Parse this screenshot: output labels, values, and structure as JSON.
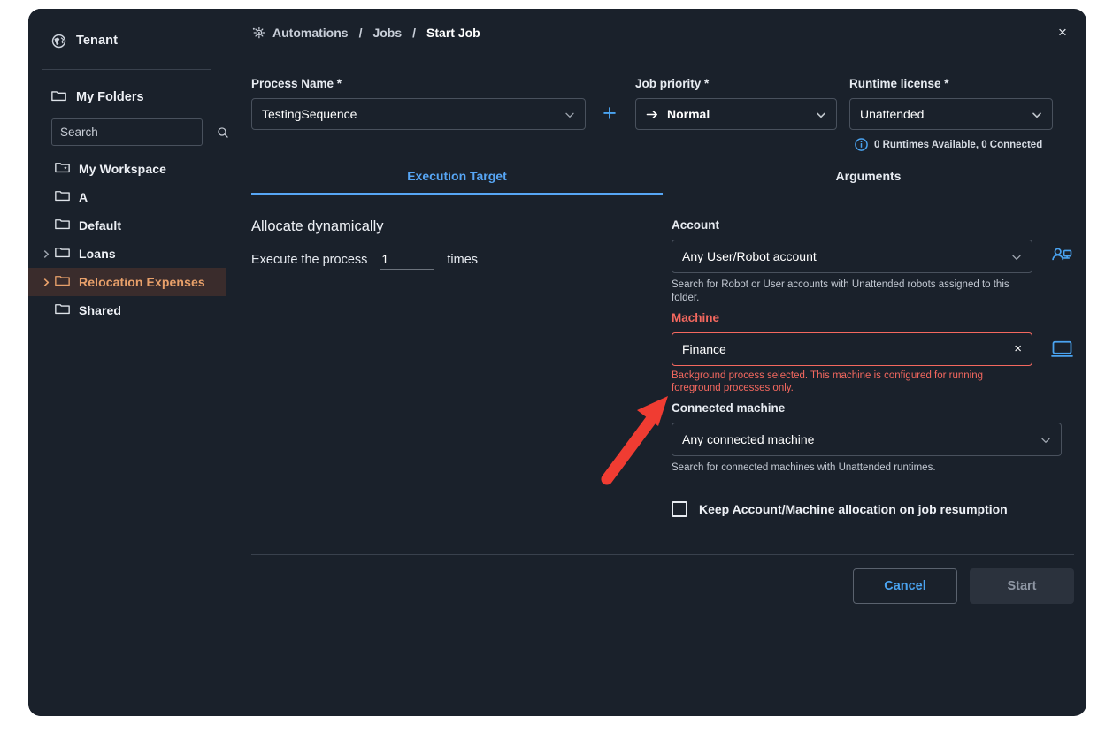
{
  "sidebar": {
    "tenant_label": "Tenant",
    "tenant_icon": "globe-icon",
    "my_folders_label": "My Folders",
    "search": {
      "placeholder": "Search",
      "value": "",
      "icon": "search-icon"
    },
    "items": [
      {
        "label": "My Workspace",
        "icon": "workspace-folder-icon",
        "expandable": false,
        "selected": false
      },
      {
        "label": "A",
        "icon": "folder-icon",
        "expandable": false,
        "selected": false
      },
      {
        "label": "Default",
        "icon": "folder-icon",
        "expandable": false,
        "selected": false
      },
      {
        "label": "Loans",
        "icon": "folder-icon",
        "expandable": true,
        "selected": false
      },
      {
        "label": "Relocation Expenses",
        "icon": "folder-icon",
        "expandable": true,
        "selected": true
      },
      {
        "label": "Shared",
        "icon": "folder-icon",
        "expandable": false,
        "selected": false
      }
    ]
  },
  "header": {
    "breadcrumb": [
      {
        "label": "Automations",
        "current": false
      },
      {
        "label": "Jobs",
        "current": false
      },
      {
        "label": "Start Job",
        "current": true
      }
    ],
    "separator": "/",
    "automation_icon": "automation-gear-icon",
    "close_icon": "close-icon",
    "close_label": "×"
  },
  "form": {
    "process": {
      "label": "Process Name *",
      "value": "TestingSequence",
      "add_icon": "plus-icon",
      "add_label": "+"
    },
    "priority": {
      "label": "Job priority *",
      "value": "Normal",
      "icon": "arrow-right-icon"
    },
    "license": {
      "label": "Runtime license *",
      "value": "Unattended",
      "runtime_note": "0 Runtimes Available, 0 Connected",
      "note_icon": "info-icon"
    }
  },
  "tabs": [
    {
      "label": "Execution Target",
      "active": true
    },
    {
      "label": "Arguments",
      "active": false
    }
  ],
  "execution_target": {
    "allocate_title": "Allocate dynamically",
    "execute_prefix": "Execute the process",
    "execute_count": "1",
    "execute_suffix": "times",
    "account": {
      "label": "Account",
      "value": "Any User/Robot account",
      "helper": "Search for Robot or User accounts with Unattended robots assigned to this folder.",
      "side_icon": "add-user-robot-icon"
    },
    "machine": {
      "label": "Machine",
      "value": "Finance",
      "error": "Background process selected. This machine is configured for running foreground processes only.",
      "clear_label": "×",
      "clear_icon": "clear-icon",
      "side_icon": "monitor-icon",
      "has_error": true
    },
    "connected_machine": {
      "label": "Connected machine",
      "value": "Any connected machine",
      "helper": "Search for connected machines with Unattended runtimes."
    },
    "keep_allocation": {
      "label": "Keep Account/Machine allocation on job resumption",
      "checked": false
    }
  },
  "footer": {
    "cancel_label": "Cancel",
    "start_label": "Start"
  },
  "annotation": {
    "type": "arrow",
    "color": "#f03c32",
    "points_to": "machine-error-text"
  },
  "colors": {
    "panel_bg": "#1a212b",
    "accent_blue": "#4aa3f0",
    "tab_active": "#57a6f5",
    "error_red": "#f4685f",
    "selected_row_bg": "#3a2c2c",
    "selected_row_text": "#e8a06a",
    "annotation_red": "#f03c32"
  }
}
